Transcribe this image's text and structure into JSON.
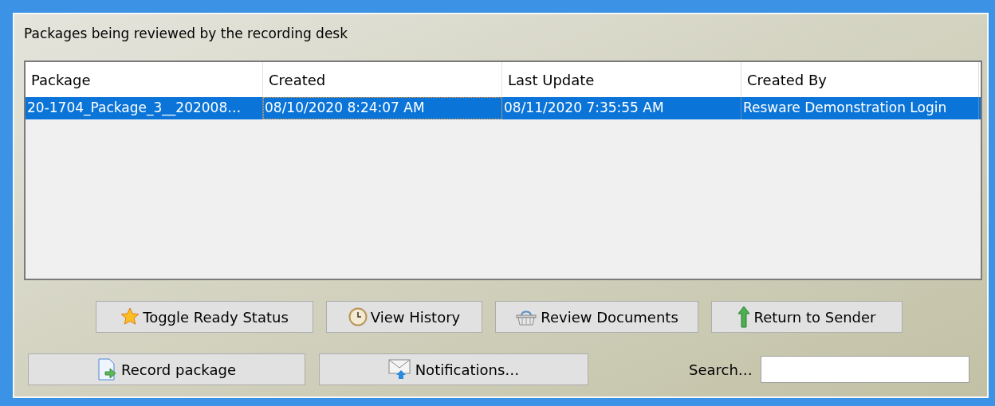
{
  "caption": "Packages being reviewed by the recording desk",
  "table": {
    "columns": [
      "Package",
      "Created",
      "Last Update",
      "Created By"
    ],
    "rows": [
      {
        "selected": true,
        "cells": [
          "20-1704_Package_3__202008…",
          "08/10/2020 8:24:07 AM",
          "08/11/2020 7:35:55 AM",
          "Resware Demonstration Login"
        ]
      }
    ]
  },
  "action_buttons": [
    {
      "label": "Toggle Ready Status"
    },
    {
      "label": "View History"
    },
    {
      "label": "Review Documents"
    },
    {
      "label": "Return to Sender"
    }
  ],
  "bottom_buttons": [
    {
      "label": "Record package"
    },
    {
      "label": "Notifications…"
    }
  ],
  "search": {
    "label": "Search…"
  }
}
